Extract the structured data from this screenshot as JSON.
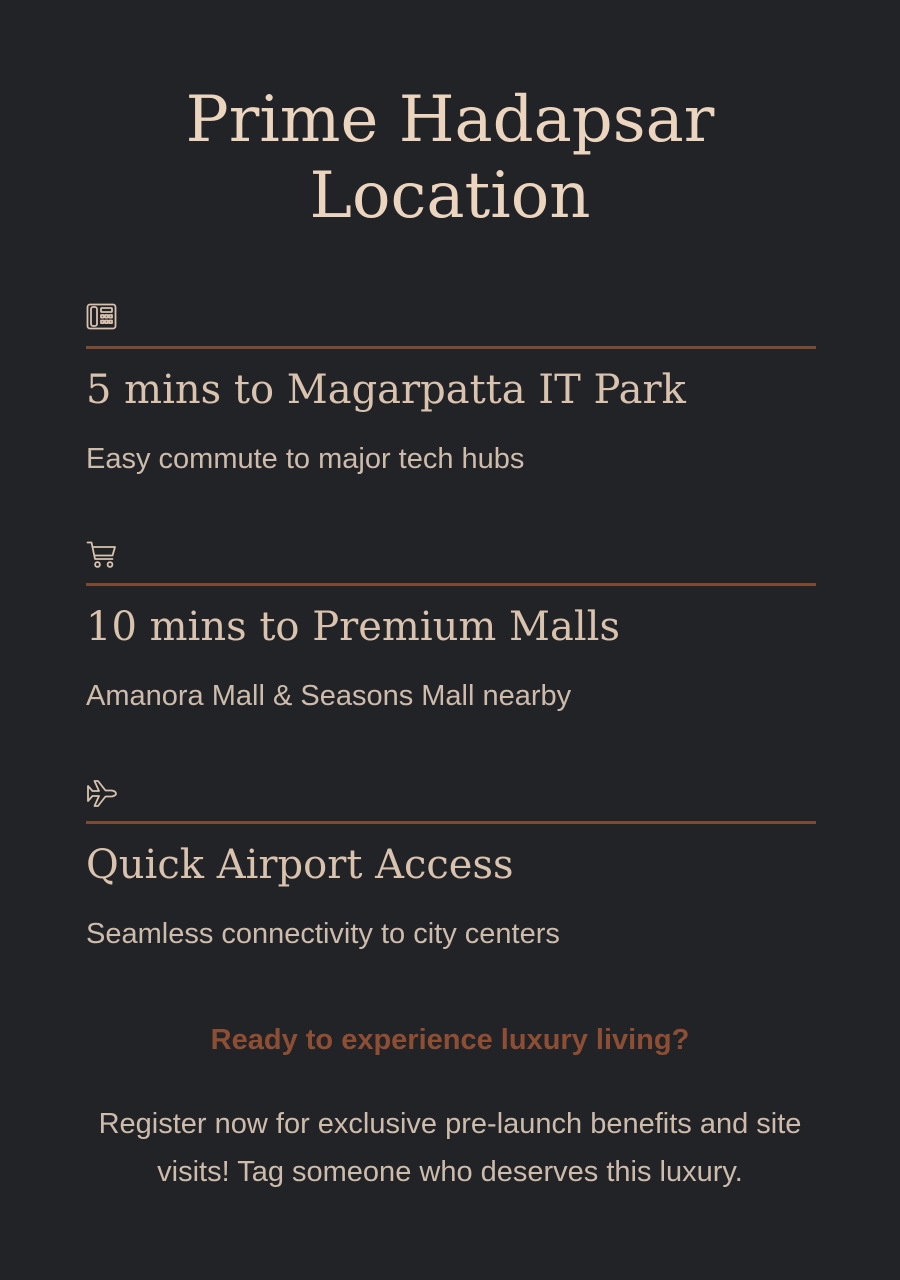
{
  "title": {
    "line1": "Prime Hadapsar",
    "line2": "Location"
  },
  "features": [
    {
      "icon": "telephone-icon",
      "heading": "5 mins to Magarpatta IT Park",
      "description": "Easy commute to major tech hubs"
    },
    {
      "icon": "shopping-cart-icon",
      "heading": "10 mins to Premium Malls",
      "description": "Amanora Mall & Seasons Mall nearby"
    },
    {
      "icon": "airplane-icon",
      "heading": "Quick Airport Access",
      "description": "Seamless connectivity to city centers"
    }
  ],
  "cta": {
    "heading": "Ready to experience luxury living?",
    "body": "Register now for exclusive pre-launch benefits and site visits! Tag someone who deserves this luxury."
  },
  "colors": {
    "background": "#222327",
    "title": "#ecd5bf",
    "heading": "#d9c2ae",
    "text": "#cdbcab",
    "accent_rule": "#7c4a33",
    "cta_accent": "#8e4e33",
    "icon": "#d8c2ae"
  }
}
